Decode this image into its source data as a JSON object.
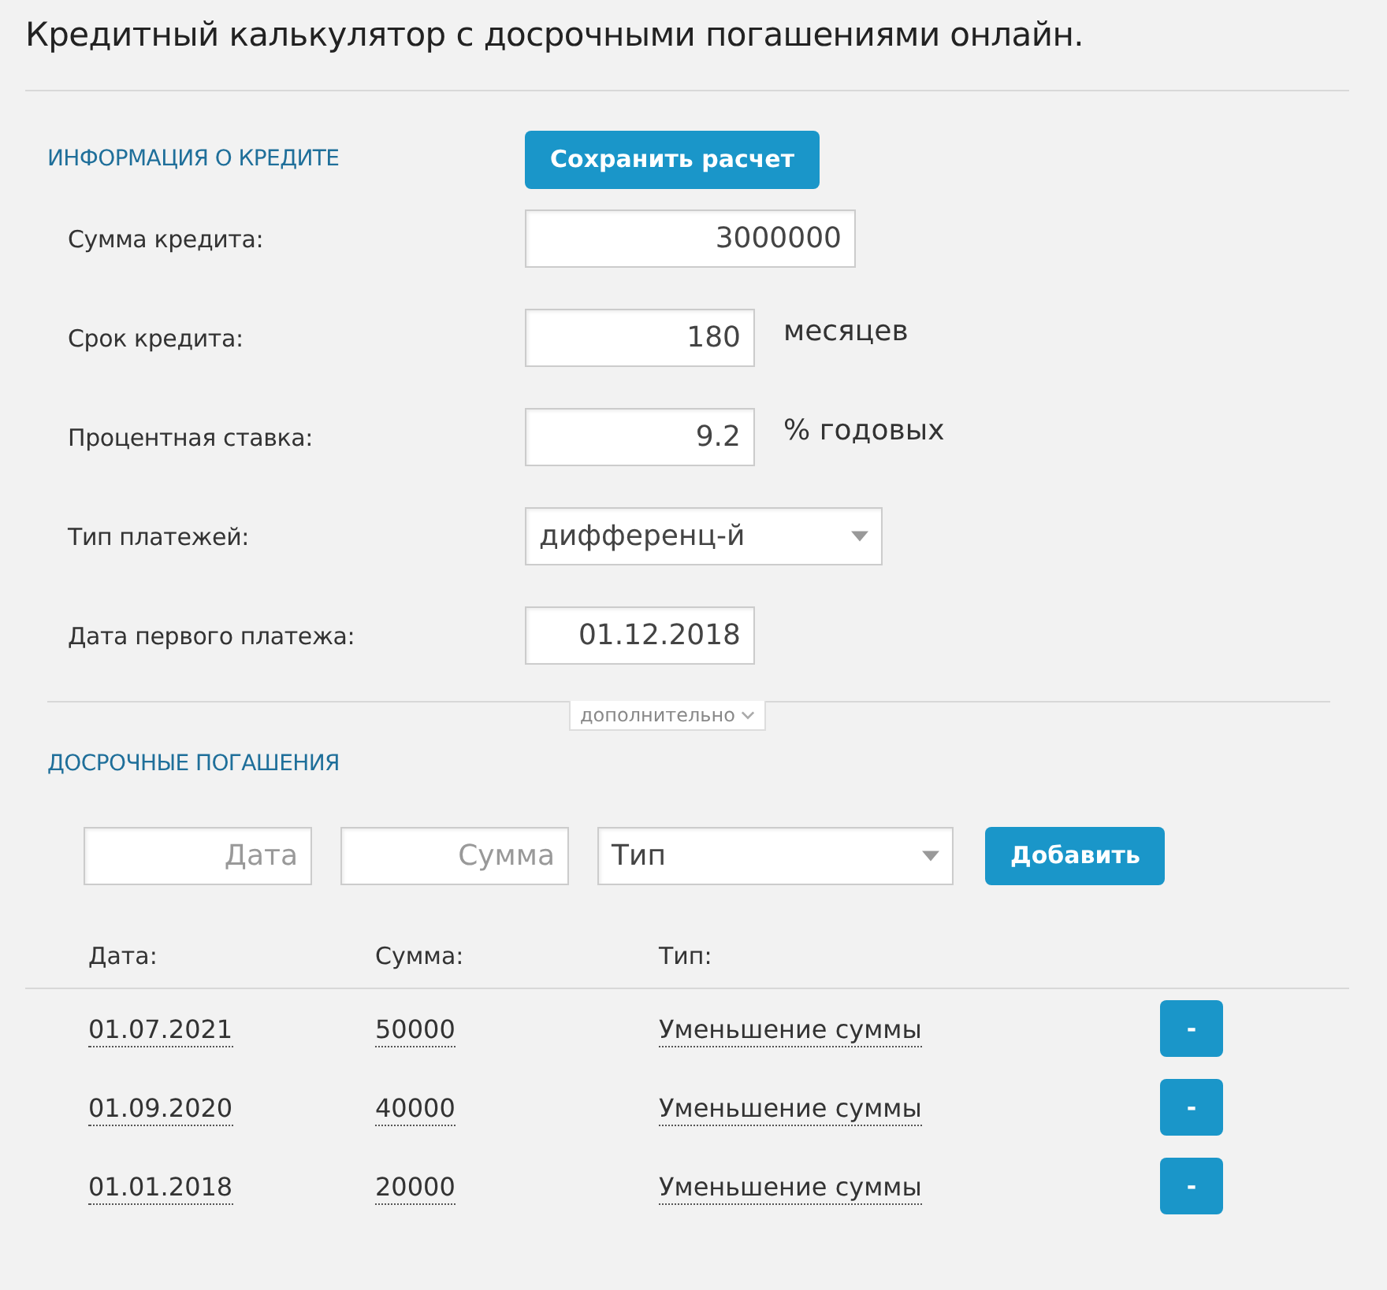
{
  "title": "Кредитный калькулятор с досрочными погашениями онлайн.",
  "loan_info": {
    "heading": "ИНФОРМАЦИЯ О КРЕДИТЕ",
    "save_button": "Сохранить расчет",
    "fields": [
      {
        "kind": "input",
        "label": "Сумма кредита:",
        "value": "3000000"
      },
      {
        "kind": "input",
        "label": "Срок кредита:",
        "value": "180",
        "suffix": "месяцев"
      },
      {
        "kind": "input",
        "label": "Процентная ставка:",
        "value": "9.2",
        "suffix": "% годовых"
      },
      {
        "kind": "select",
        "label": "Тип платежей:",
        "value": "дифференц-й"
      },
      {
        "kind": "date",
        "label": "Дата первого платежа:",
        "value": "01.12.2018"
      }
    ]
  },
  "more_toggle": "дополнительно",
  "prepayments": {
    "heading": "ДОСРОЧНЫЕ ПОГАШЕНИЯ",
    "date_field": {
      "placeholder": "Дата"
    },
    "amount_field": {
      "placeholder": "Сумма"
    },
    "type_select": {
      "value": "Тип"
    },
    "add_button": "Добавить",
    "columns": [
      "Дата:",
      "Сумма:",
      "Тип:"
    ],
    "rows": [
      {
        "date": "01.07.2021",
        "amount": "50000",
        "type": "Уменьшение суммы",
        "remove": "-"
      },
      {
        "date": "01.09.2020",
        "amount": "40000",
        "type": "Уменьшение суммы",
        "remove": "-"
      },
      {
        "date": "01.01.2018",
        "amount": "20000",
        "type": "Уменьшение суммы",
        "remove": "-"
      }
    ]
  }
}
